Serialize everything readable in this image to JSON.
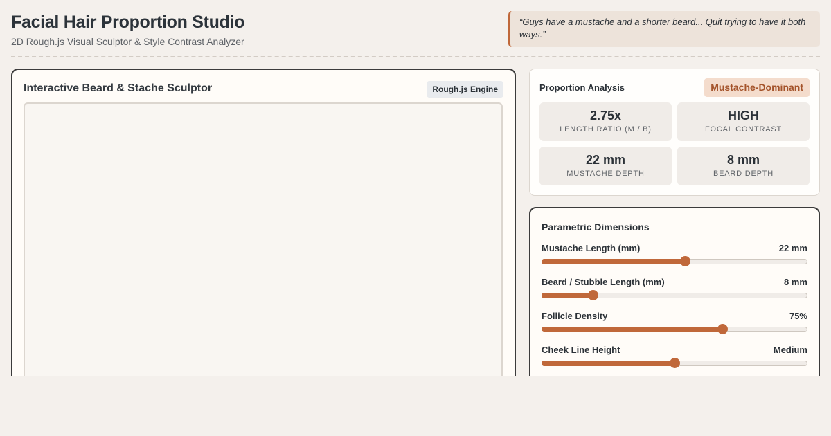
{
  "header": {
    "title": "Facial Hair Proportion Studio",
    "subtitle": "2D Rough.js Visual Sculptor & Style Contrast Analyzer",
    "quote": "“Guys have a mustache and a shorter beard... Quit trying to have it both ways.”"
  },
  "sculptor": {
    "title": "Interactive Beard & Stache Sculptor",
    "engine_badge": "Rough.js Engine"
  },
  "analysis": {
    "title": "Proportion Analysis",
    "dominance": "Mustache-Dominant",
    "metrics": [
      {
        "value": "2.75x",
        "label": "Length Ratio (M / B)"
      },
      {
        "value": "HIGH",
        "label": "Focal Contrast"
      },
      {
        "value": "22 mm",
        "label": "Mustache Depth"
      },
      {
        "value": "8 mm",
        "label": "Beard Depth"
      }
    ]
  },
  "params": {
    "title": "Parametric Dimensions",
    "sliders": [
      {
        "label": "Mustache Length (mm)",
        "value": "22 mm",
        "fraction": 0.54
      },
      {
        "label": "Beard / Stubble Length (mm)",
        "value": "8 mm",
        "fraction": 0.19
      },
      {
        "label": "Follicle Density",
        "value": "75%",
        "fraction": 0.68
      },
      {
        "label": "Cheek Line Height",
        "value": "Medium",
        "fraction": 0.5
      }
    ]
  },
  "colors": {
    "accent": "#c0683a",
    "accent_dark": "#a4532a",
    "background": "#f4f0ec"
  }
}
